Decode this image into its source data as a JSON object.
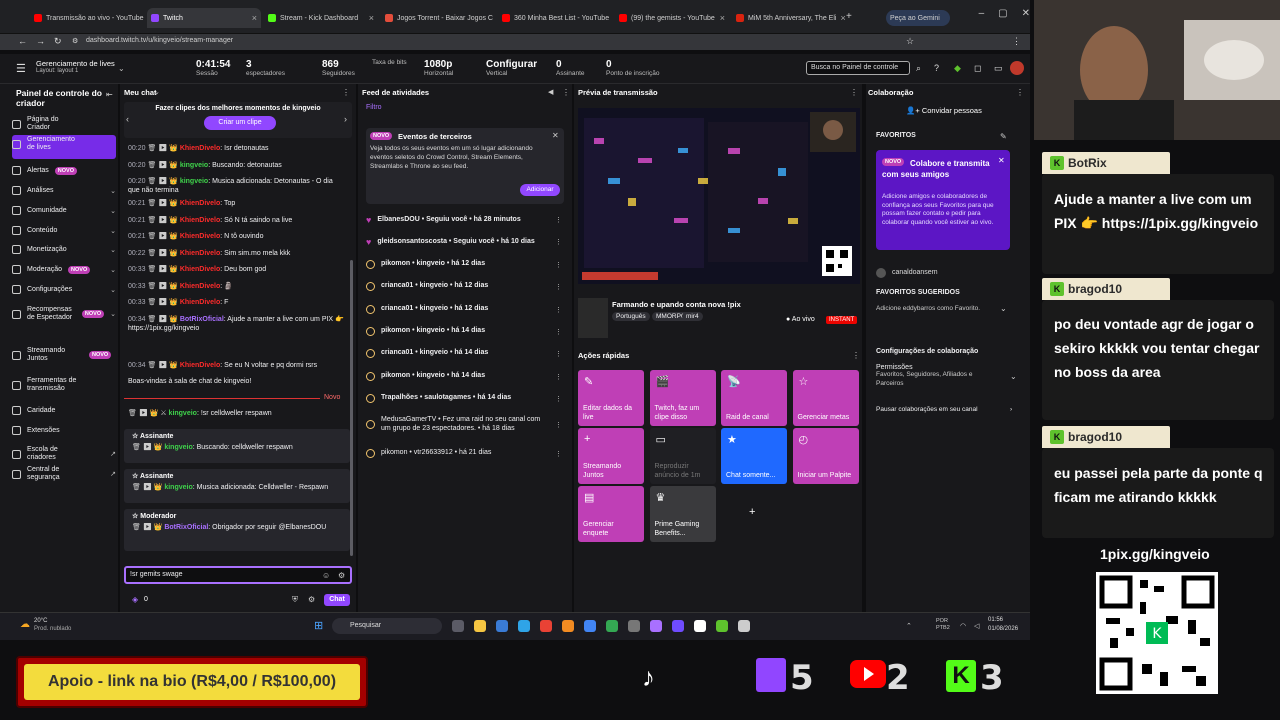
{
  "browser": {
    "tabs": [
      {
        "label": "Transmissão ao vivo - YouTube",
        "color": "#ff0000"
      },
      {
        "label": "Twitch",
        "color": "#9147ff"
      },
      {
        "label": "Stream - Kick Dashboard",
        "color": "#53fc18"
      },
      {
        "label": "Jogos Torrent - Baixar Jogos C",
        "color": "#e34d3b"
      },
      {
        "label": "360 Minha Best List - YouTube",
        "color": "#ff0000"
      },
      {
        "label": "(99) the gemists - YouTube",
        "color": "#ff0000"
      },
      {
        "label": "MiM 5th Anniversary, The Eli",
        "color": "#d9230f"
      }
    ],
    "gemini_tab": "Peça ao Gemini",
    "url": "dashboard.twitch.tv/u/kingveio/stream-manager"
  },
  "topbar": {
    "manager_title": "Gerenciamento de lives",
    "manager_sub": "Layout: layout 1",
    "stats": [
      {
        "value": "0:41:54",
        "label": "Sessão"
      },
      {
        "value": "3",
        "label": "espectadores"
      },
      {
        "value": "869",
        "label": "Seguidores"
      },
      {
        "value": "",
        "label": "Taxa de bits"
      },
      {
        "value": "1080p",
        "label": "Horizontal"
      },
      {
        "value": "Configurar",
        "label": "Vertical"
      },
      {
        "value": "0",
        "label": "Assinante"
      },
      {
        "value": "0",
        "label": "Ponto de inscrição"
      }
    ],
    "search_placeholder": "Busca no Painel de controle"
  },
  "sidenav": {
    "title": "Painel de controle do criador",
    "items": [
      {
        "label": "Página do Criador",
        "novo": "",
        "chev": ""
      },
      {
        "label": "Gerenciamento de lives",
        "novo": "",
        "chev": ""
      },
      {
        "label": "Alertas",
        "novo": "NOVO",
        "chev": ""
      },
      {
        "label": "Análises",
        "novo": "",
        "chev": "⌄"
      },
      {
        "label": "Comunidade",
        "novo": "",
        "chev": "⌄"
      },
      {
        "label": "Conteúdo",
        "novo": "",
        "chev": "⌄"
      },
      {
        "label": "Monetização",
        "novo": "",
        "chev": "⌄"
      },
      {
        "label": "Moderação",
        "novo": "NOVO",
        "chev": "⌄"
      },
      {
        "label": "Configurações",
        "novo": "",
        "chev": "⌄"
      },
      {
        "label": "Recompensas de Espectador",
        "novo": "NOVO",
        "chev": "⌄"
      },
      {
        "label": "Streamando Juntos",
        "novo": "NOVO",
        "chev": ""
      },
      {
        "label": "Ferramentas de transmissão",
        "novo": "",
        "chev": ""
      },
      {
        "label": "Caridade",
        "novo": "",
        "chev": ""
      },
      {
        "label": "Extensões",
        "novo": "",
        "chev": ""
      },
      {
        "label": "Escola de criadores",
        "novo": "",
        "chev": "↗"
      },
      {
        "label": "Central de segurança",
        "novo": "",
        "chev": "↗"
      }
    ]
  },
  "chat": {
    "title": "Meu chat",
    "clip_prompt": "Fazer clipes dos melhores momentos de kingveio",
    "clip_button": "Criar um clipe",
    "lines": [
      {
        "t": "00:20",
        "u": "KhienDivelo",
        "c": "r",
        "m": "Isr detonautas"
      },
      {
        "t": "00:20",
        "u": "kingveio",
        "c": "g",
        "m": "Buscando: detonautas"
      },
      {
        "t": "00:20",
        "u": "kingveio",
        "c": "g",
        "m": "Musica adicionada: Detonautas - O dia que não termina"
      },
      {
        "t": "00:21",
        "u": "KhienDivelo",
        "c": "r",
        "m": "Top"
      },
      {
        "t": "00:21",
        "u": "KhienDivelo",
        "c": "r",
        "m": "Só N tá saindo na live"
      },
      {
        "t": "00:21",
        "u": "KhienDivelo",
        "c": "r",
        "m": "N tô ouvindo"
      },
      {
        "t": "00:22",
        "u": "KhienDivelo",
        "c": "r",
        "m": "Sim sim.mo mela kkk"
      },
      {
        "t": "00:33",
        "u": "KhienDivelo",
        "c": "r",
        "m": "Deu bom god"
      },
      {
        "t": "00:33",
        "u": "KhienDivelo",
        "c": "r",
        "m": "🗿"
      },
      {
        "t": "00:33",
        "u": "KhienDivelo",
        "c": "r",
        "m": "F"
      },
      {
        "t": "00:34",
        "u": "BotRixOficial",
        "c": "p",
        "m": "Ajude a manter a live com um PIX 👉 https://1pix.gg/kingveio"
      },
      {
        "t": "00:34",
        "u": "KhienDivelo",
        "c": "r",
        "m": "Se eu N voltar e pq dormi rsrs"
      },
      {
        "t": "",
        "u": "",
        "c": "",
        "m": "Boas-vindas à sala de chat de kingveio!"
      }
    ],
    "novo_label": "Novo",
    "last_line": {
      "u": "kingveio",
      "m": "!sr celldweller respawn"
    },
    "pinned": [
      {
        "role": "Assinante",
        "u": "kingveio",
        "m": "Buscando: celldweller respawn"
      },
      {
        "role": "Assinante",
        "u": "kingveio",
        "m": "Musica adicionada: Celldweller - Respawn"
      },
      {
        "role": "Moderador",
        "u": "BotRixOficial",
        "m": "Obrigador por seguir @ElbanesDOU"
      }
    ],
    "input_value": "!sr gemits swage",
    "points": "0",
    "send_label": "Chat"
  },
  "feed": {
    "title": "Feed de atividades",
    "filter": "Filtro",
    "card": {
      "badge": "NOVO",
      "title": "Eventos de terceiros",
      "body": "Veja todos os seus eventos em um só lugar adicionando eventos seletos do Crowd Control, Stream Elements, Streamlabs e Throne ao seu feed.",
      "button": "Adicionar"
    },
    "items": [
      {
        "icon": "heart",
        "text": "ElbanesDOU • Seguiu você • há 28 minutos"
      },
      {
        "icon": "heart",
        "text": "gleidsonsantoscosta • Seguiu você • há 10 dias"
      },
      {
        "icon": "coin",
        "text": "pikomon • kingveio • há 12 dias"
      },
      {
        "icon": "coin",
        "text": "crianca01 • kingveio • há 12 dias"
      },
      {
        "icon": "coin",
        "text": "crianca01 • kingveio • há 12 dias"
      },
      {
        "icon": "coin",
        "text": "pikomon • kingveio • há 14 dias"
      },
      {
        "icon": "coin",
        "text": "crianca01 • kingveio • há 14 dias"
      },
      {
        "icon": "coin",
        "text": "pikomon • kingveio • há 14 dias"
      },
      {
        "icon": "coin",
        "text": "Trapalhões • saulotagames • há 14 dias"
      },
      {
        "icon": "coin",
        "text": "MedusaGamerTV • Fez uma raid no seu canal com um grupo de 23 espectadores. • há 18 dias"
      },
      {
        "icon": "coin",
        "text": "pikomon • vtr26633912 • há 21 dias"
      }
    ]
  },
  "preview": {
    "title": "Prévia de transmissão",
    "stream_title": "Farmando e upando conta nova !pix",
    "tags": [
      "Português",
      "MMORPG",
      "mir4"
    ],
    "live_label": "Ao vivo",
    "instant": "INSTANT",
    "quick_title": "Ações rápidas",
    "actions": [
      {
        "label": "Editar dados da live",
        "color": "#bf3fb6",
        "icon": "✎"
      },
      {
        "label": "Twitch, faz um clipe disso",
        "color": "#bf3fb6",
        "icon": "🎬"
      },
      {
        "label": "Raid de canal",
        "color": "#bf3fb6",
        "icon": "📡"
      },
      {
        "label": "Gerenciar metas",
        "color": "#bf3fb6",
        "icon": "☆"
      },
      {
        "label": "Streamando Juntos",
        "color": "#bf3fb6",
        "icon": "+"
      },
      {
        "label": "Reproduzir anúncio de 1m",
        "color": "#1f1f23",
        "icon": "▭"
      },
      {
        "label": "Chat somente...",
        "color": "#1f69ff",
        "icon": "★"
      },
      {
        "label": "Iniciar um Palpite",
        "color": "#bf3fb6",
        "icon": "◴"
      },
      {
        "label": "Gerenciar enquete",
        "color": "#bf3fb6",
        "icon": "▤"
      },
      {
        "label": "Prime Gaming Benefits...",
        "color": "#3a3a3d",
        "icon": "♛"
      },
      {
        "label": "",
        "color": "#18181b",
        "icon": "+"
      }
    ]
  },
  "collab": {
    "title": "Colaboração",
    "invite": "Convidar pessoas",
    "favoritos": "FAVORITOS",
    "card": {
      "badge": "NOVO",
      "title": "Colabore e transmita com seus amigos",
      "body": "Adicione amigos e colaboradores de confiança aos seus Favoritos para que possam fazer contato e pedir para colaborar quando você estiver ao vivo."
    },
    "channel": "canaldoansem",
    "suggested_title": "FAVORITOS SUGERIDOS",
    "suggested_item": "Adicione eddybarros como Favorito.",
    "config_title": "Configurações de colaboração",
    "perm_title": "Permissões",
    "perm_value": "Favoritos, Seguidores, Afiliados e Parceiros",
    "pause": "Pausar colaborações em seu canal"
  },
  "taskbar": {
    "weather_temp": "20°C",
    "weather_desc": "Prod. nublado",
    "search": "Pesquisar",
    "lang": "POR PTB2",
    "time": "01:56",
    "date": "01/08/2026"
  },
  "overlay": {
    "bubbles": [
      {
        "name": "BotRix",
        "msg": "Ajude a manter a live com um PIX 👉 https://1pix.gg/kingveio"
      },
      {
        "name": "bragod10",
        "msg": "po deu vontade agr de jogar o sekiro kkkkk vou tentar chegar no boss da area"
      },
      {
        "name": "bragod10",
        "msg": "eu passei pela parte da ponte q ficam me atirando kkkkk"
      }
    ],
    "pix_url": "1pix.gg/kingveio",
    "support": "Apoio - link na bio (R$4,00 / R$100,00)",
    "counts": {
      "twitch": "5",
      "youtube": "2",
      "kick": "3"
    }
  }
}
